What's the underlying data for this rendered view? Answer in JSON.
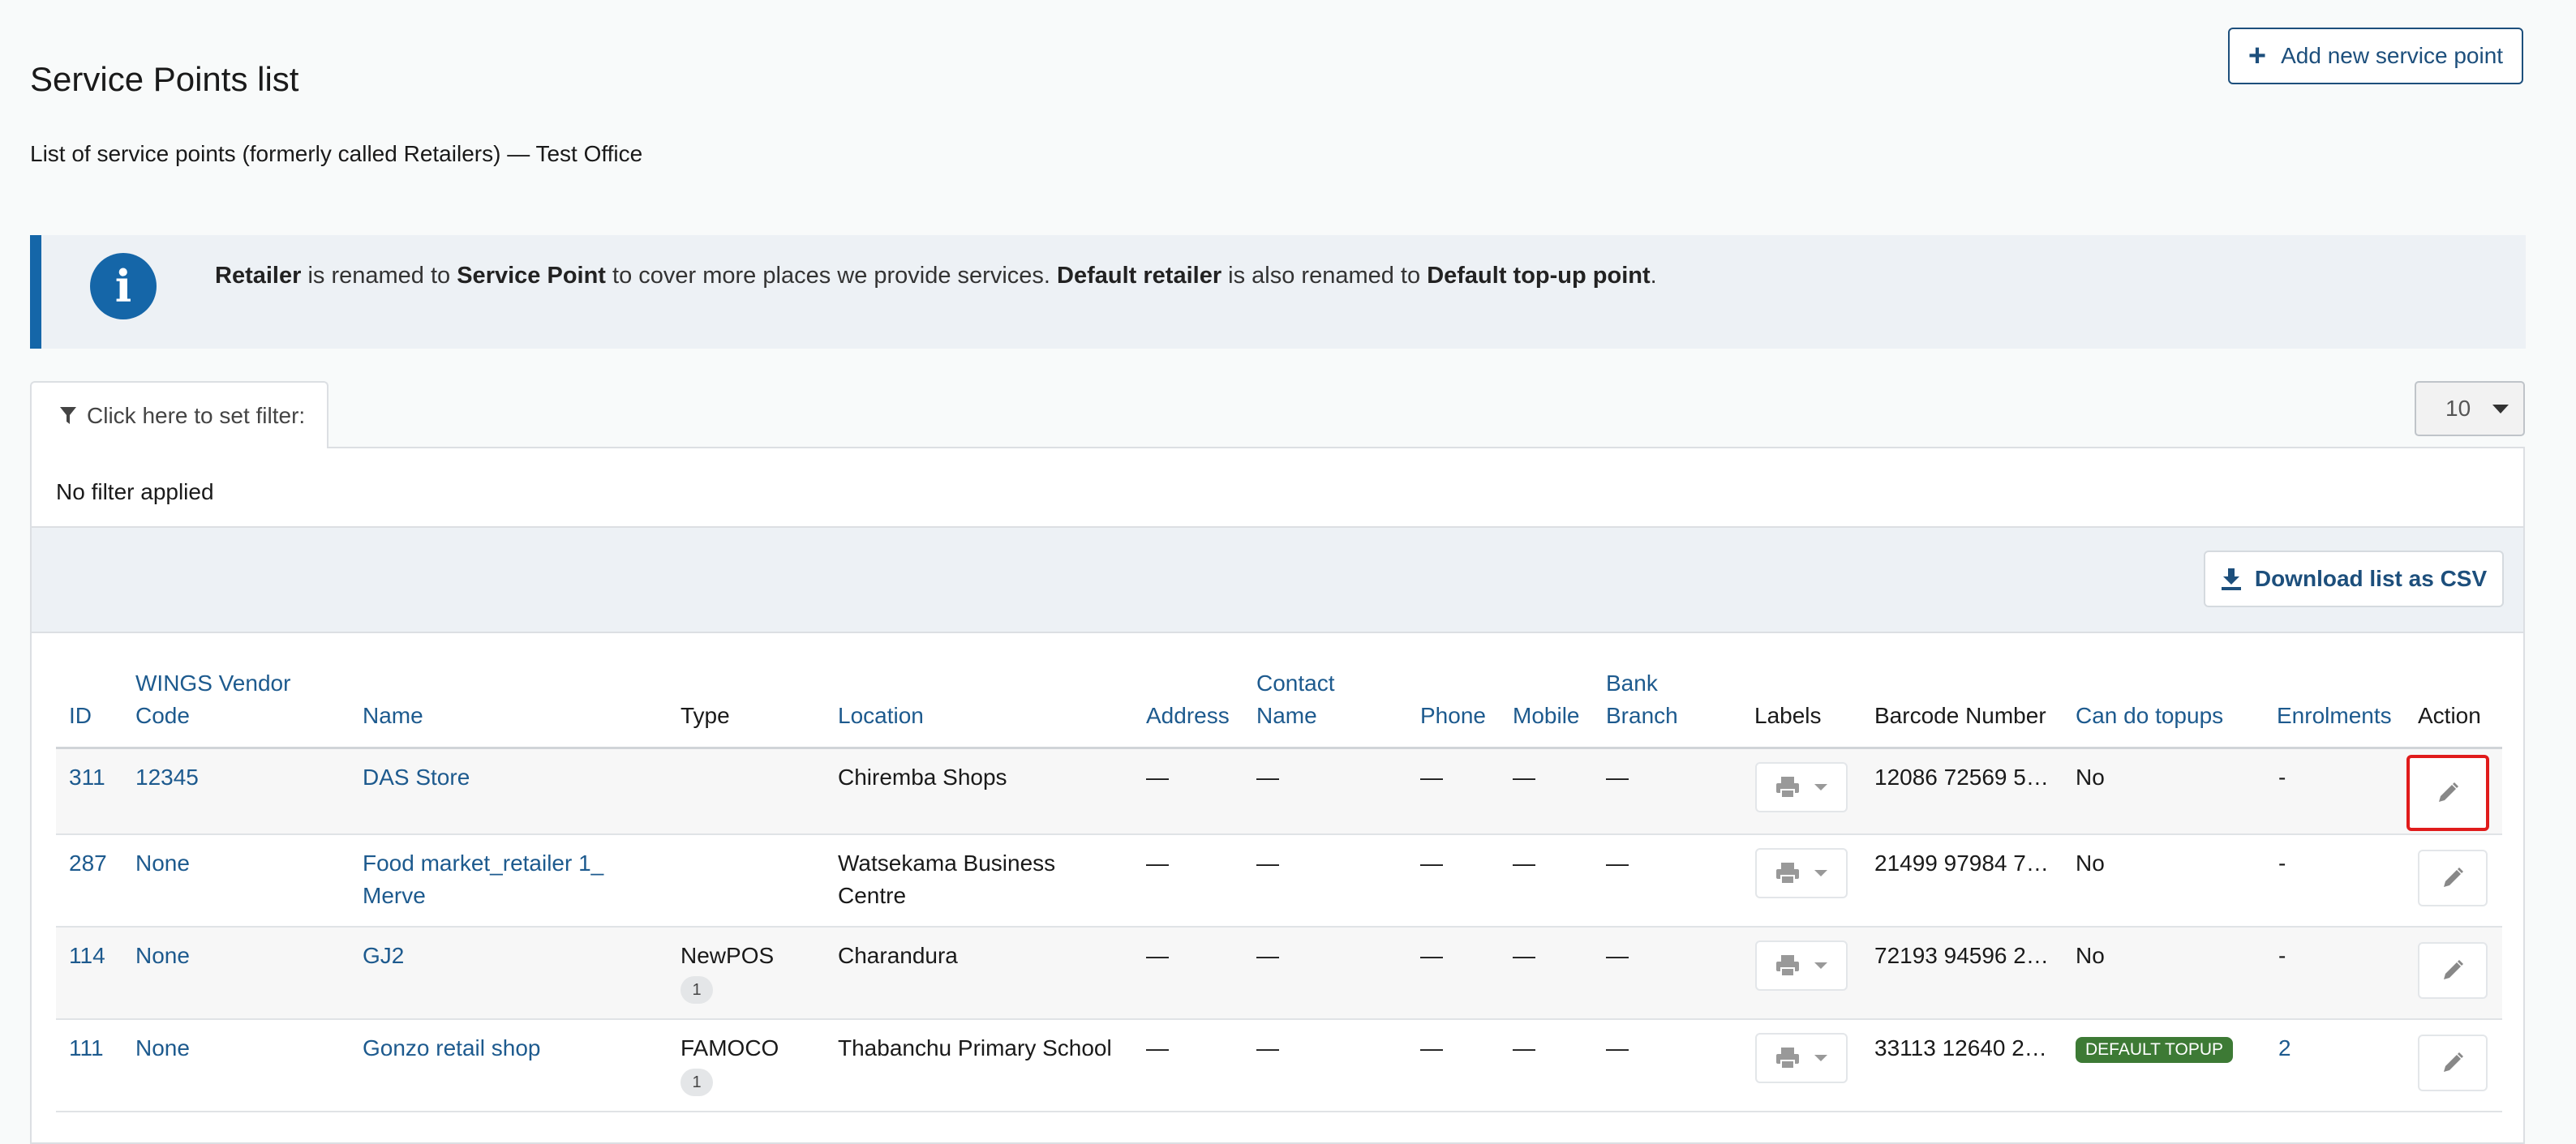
{
  "page": {
    "title": "Service Points list",
    "subtitle": "List of service points (formerly called Retailers) — Test Office",
    "add_button_label": "Add new service point"
  },
  "info": {
    "icon": "info-icon",
    "part1_bold": "Retailer",
    "part2": " is renamed to ",
    "part3_bold": "Service Point",
    "part4": " to cover more places we provide services. ",
    "part5_bold": "Default retailer",
    "part6": " is also renamed to ",
    "part7_bold": "Default top-up point",
    "part8": "."
  },
  "filter": {
    "tab_label": "Click here to set filter:",
    "status": "No filter applied",
    "page_size": "10"
  },
  "toolbar": {
    "csv_label": "Download list as CSV"
  },
  "table": {
    "headers": {
      "id": "ID",
      "vendor_line1": "WINGS Vendor",
      "vendor_line2": "Code",
      "name": "Name",
      "type": "Type",
      "location": "Location",
      "address": "Address",
      "contact_line1": "Contact",
      "contact_line2": "Name",
      "phone": "Phone",
      "mobile": "Mobile",
      "bank_line1": "Bank",
      "bank_line2": "Branch",
      "labels": "Labels",
      "barcode": "Barcode Number",
      "topups": "Can do topups",
      "enrolments": "Enrolments",
      "action": "Action"
    },
    "rows": [
      {
        "id": "311",
        "vendor": "12345",
        "name_line1": "DAS Store",
        "name_line2": "",
        "type": "",
        "type_count": "",
        "location_line1": "Chiremba Shops",
        "location_line2": "",
        "address": "—",
        "contact": "—",
        "phone": "—",
        "mobile": "—",
        "bank": "—",
        "barcode": "12086 72569 5…",
        "topups": "No",
        "topup_badge": "",
        "enrolments": "-"
      },
      {
        "id": "287",
        "vendor": "None",
        "name_line1": "Food market_retailer 1_",
        "name_line2": "Merve",
        "type": "",
        "type_count": "",
        "location_line1": "Watsekama Business",
        "location_line2": "Centre",
        "address": "—",
        "contact": "—",
        "phone": "—",
        "mobile": "—",
        "bank": "—",
        "barcode": "21499 97984 7…",
        "topups": "No",
        "topup_badge": "",
        "enrolments": "-"
      },
      {
        "id": "114",
        "vendor": "None",
        "name_line1": "GJ2",
        "name_line2": "",
        "type": "NewPOS",
        "type_count": "1",
        "location_line1": "Charandura",
        "location_line2": "",
        "address": "—",
        "contact": "—",
        "phone": "—",
        "mobile": "—",
        "bank": "—",
        "barcode": "72193 94596 2…",
        "topups": "No",
        "topup_badge": "",
        "enrolments": "-"
      },
      {
        "id": "111",
        "vendor": "None",
        "name_line1": "Gonzo retail shop",
        "name_line2": "",
        "type": "FAMOCO",
        "type_count": "1",
        "location_line1": "Thabanchu Primary School",
        "location_line2": "",
        "address": "—",
        "contact": "—",
        "phone": "—",
        "mobile": "—",
        "bank": "—",
        "barcode": "33113 12640 2…",
        "topups": "",
        "topup_badge": "DEFAULT TOPUP",
        "enrolments": "2"
      }
    ]
  },
  "colors": {
    "link": "#1d5a8e",
    "info_accent": "#1566a8",
    "topup_badge": "#3d7a35",
    "highlight": "#e01b1b"
  }
}
